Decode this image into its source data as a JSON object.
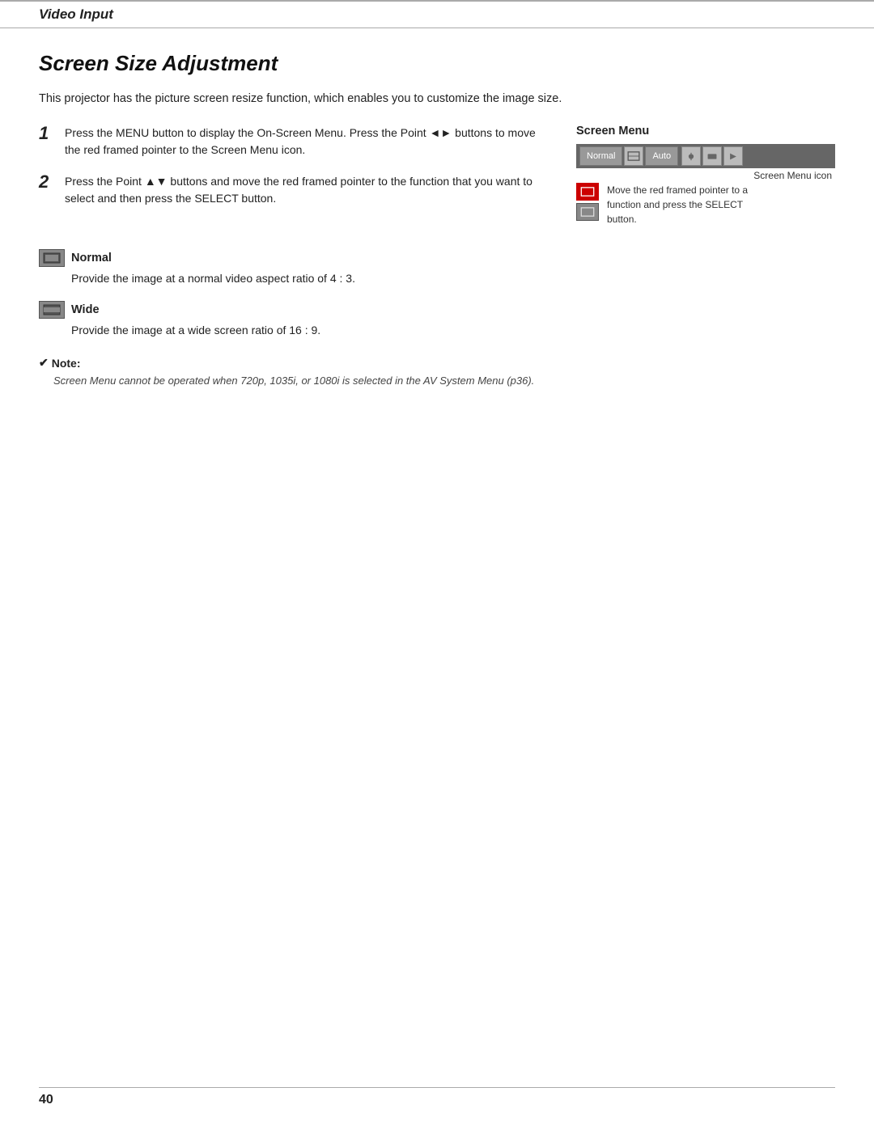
{
  "header": {
    "title": "Video Input"
  },
  "page": {
    "title": "Screen Size Adjustment",
    "intro": "This projector has the picture screen resize function, which enables you to customize the image size."
  },
  "steps": [
    {
      "number": "1",
      "text": "Press the MENU button to display the On-Screen Menu.  Press the Point ◄► buttons to move the red framed pointer to the Screen Menu icon."
    },
    {
      "number": "2",
      "text": "Press the Point ▲▼ buttons and move the red framed pointer to the function that you want to select and then press the SELECT button."
    }
  ],
  "screen_menu": {
    "label": "Screen Menu",
    "normal_label": "Normal",
    "auto_label": "Auto",
    "screen_menu_icon_text": "Screen Menu icon",
    "annotation_text": "Move the red framed pointer to a function and press the SELECT button."
  },
  "modes": [
    {
      "name": "Normal",
      "description": "Provide the image at a normal video aspect ratio of 4 : 3."
    },
    {
      "name": "Wide",
      "description": "Provide the image at a wide screen ratio of 16 : 9."
    }
  ],
  "note": {
    "label": "Note:",
    "text": "Screen Menu cannot be operated when 720p, 1035i, or 1080i is selected in the AV System Menu (p36)."
  },
  "footer": {
    "page_number": "40"
  }
}
